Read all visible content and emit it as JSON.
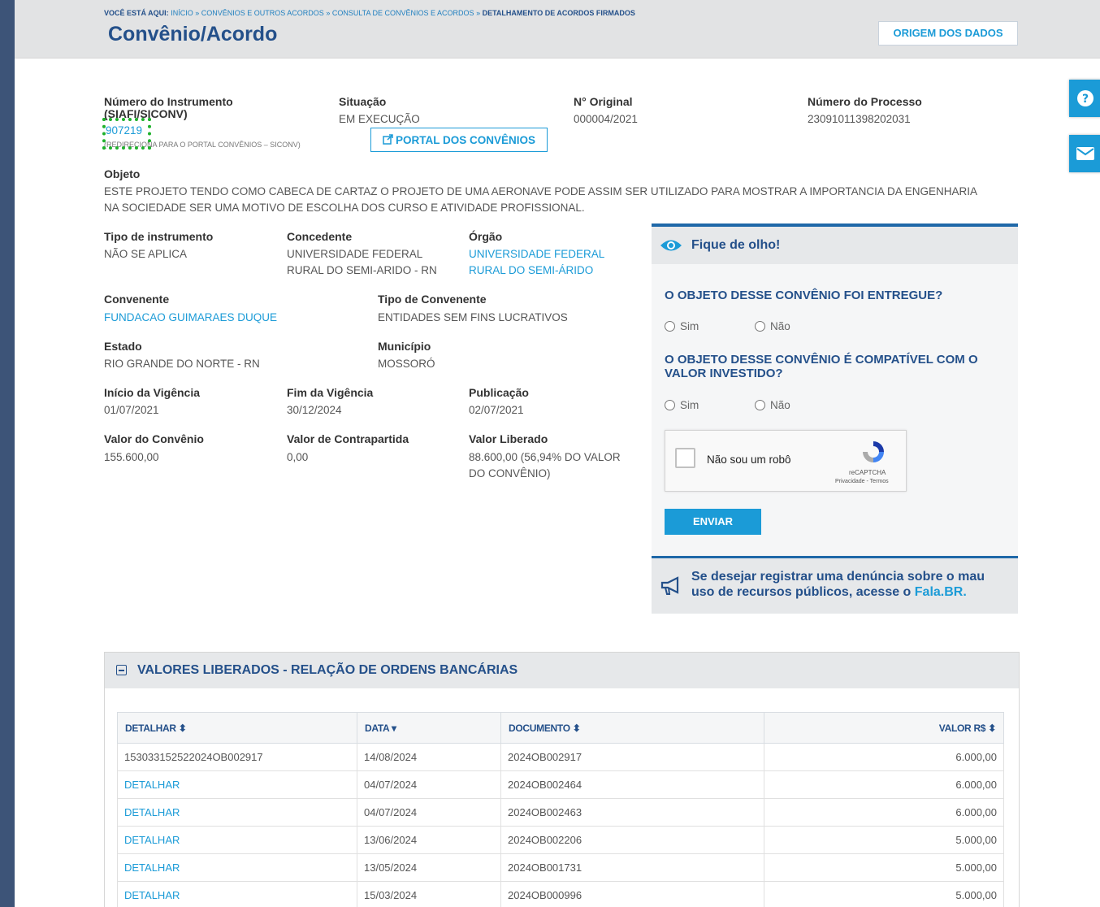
{
  "breadcrumb": {
    "prefix": "VOCÊ ESTÁ AQUI:",
    "items": [
      "INÍCIO",
      "CONVÊNIOS E OUTROS ACORDOS",
      "CONSULTA DE CONVÊNIOS E ACORDOS"
    ],
    "current": "DETALHAMENTO DE ACORDOS FIRMADOS",
    "separator": "»"
  },
  "page_title": "Convênio/Acordo",
  "origin_button": "ORIGEM DOS DADOS",
  "side_buttons": {
    "help_icon": "question-icon",
    "mail_icon": "envelope-icon"
  },
  "fields": {
    "numero_label_1": "Número do Instrumento",
    "numero_label_2": "(SIAFI/SICONV)",
    "numero_value": "907219",
    "numero_note": "(REDIRECIONA PARA O PORTAL CONVÊNIOS – SICONV)",
    "situacao_label": "Situação",
    "situacao_value": "EM EXECUÇÃO",
    "portal_button": "PORTAL DOS CONVÊNIOS",
    "original_label": "N° Original",
    "original_value": "000004/2021",
    "processo_label": "Número do Processo",
    "processo_value": "23091011398202031",
    "objeto_label": "Objeto",
    "objeto_value": "ESTE PROJETO TENDO COMO CABECA DE CARTAZ O PROJETO DE UMA AERONAVE PODE ASSIM SER UTILIZADO PARA MOSTRAR A IMPORTANCIA DA ENGENHARIA NA SOCIEDADE SER UMA MOTIVO DE ESCOLHA DOS CURSO E ATIVIDADE PROFISSIONAL.",
    "tipo_instr_label": "Tipo de instrumento",
    "tipo_instr_value": "NÃO SE APLICA",
    "concedente_label": "Concedente",
    "concedente_value_1": "UNIVERSIDADE FEDERAL",
    "concedente_value_2": "RURAL DO SEMI-ARIDO - RN",
    "orgao_label": "Órgão",
    "orgao_value_1": "UNIVERSIDADE FEDERAL",
    "orgao_value_2": "RURAL DO SEMI-ÁRIDO",
    "convenente_label": "Convenente",
    "convenente_value": "FUNDACAO GUIMARAES DUQUE",
    "tipo_conv_label": "Tipo de Convenente",
    "tipo_conv_value": "ENTIDADES SEM FINS LUCRATIVOS",
    "estado_label": "Estado",
    "estado_value": "RIO GRANDE DO NORTE - RN",
    "municipio_label": "Município",
    "municipio_value": "MOSSORÓ",
    "inicio_label": "Início da Vigência",
    "inicio_value": "01/07/2021",
    "fim_label": "Fim da Vigência",
    "fim_value": "30/12/2024",
    "publicacao_label": "Publicação",
    "publicacao_value": "02/07/2021",
    "valor_conv_label": "Valor do Convênio",
    "valor_conv_value": "155.600,00",
    "contrapartida_label": "Valor de Contrapartida",
    "contrapartida_value": "0,00",
    "liberado_label": "Valor Liberado",
    "liberado_value_1": "88.600,00 (56,94% DO VALOR",
    "liberado_value_2": "DO CONVÊNIO)"
  },
  "feedback": {
    "title": "Fique de olho!",
    "q1": "O OBJETO DESSE CONVÊNIO FOI ENTREGUE?",
    "q2": "O OBJETO DESSE CONVÊNIO É COMPATÍVEL COM O VALOR INVESTIDO?",
    "yes": "Sim",
    "no": "Não",
    "captcha_label": "Não sou um robô",
    "captcha_brand": "reCAPTCHA",
    "captcha_terms": "Privacidade - Termos",
    "submit": "ENVIAR",
    "denuncia_text": "Se desejar registrar uma denúncia sobre o mau uso de recursos públicos, acesse o ",
    "denuncia_link": "Fala.BR."
  },
  "ordens": {
    "title": "VALORES LIBERADOS - RELAÇÃO DE ORDENS BANCÁRIAS",
    "columns": [
      "DETALHAR",
      "DATA",
      "DOCUMENTO",
      "VALOR R$"
    ],
    "rows": [
      [
        "153033152522024OB002917",
        "14/08/2024",
        "2024OB002917",
        "6.000,00"
      ],
      [
        "DETALHAR",
        "04/07/2024",
        "2024OB002464",
        "6.000,00"
      ],
      [
        "DETALHAR",
        "04/07/2024",
        "2024OB002463",
        "6.000,00"
      ],
      [
        "DETALHAR",
        "13/06/2024",
        "2024OB002206",
        "5.000,00"
      ],
      [
        "DETALHAR",
        "13/05/2024",
        "2024OB001731",
        "5.000,00"
      ],
      [
        "DETALHAR",
        "15/03/2024",
        "2024OB000996",
        "5.000,00"
      ]
    ]
  }
}
